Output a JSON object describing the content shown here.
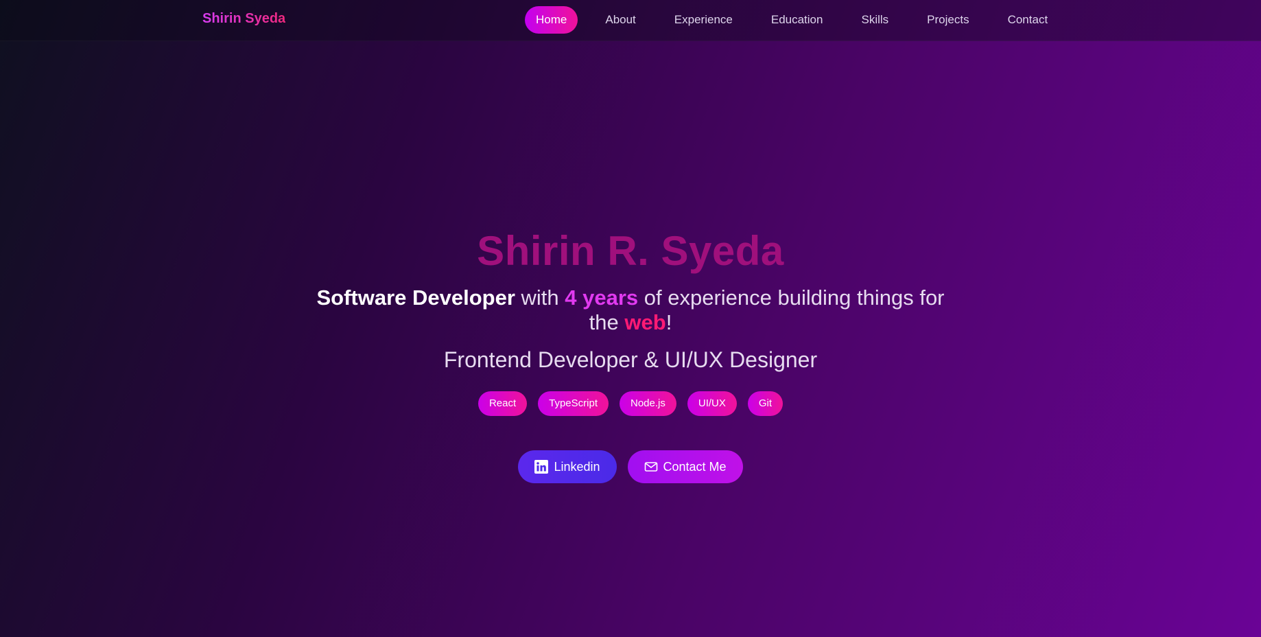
{
  "nav": {
    "brand": "Shirin Syeda",
    "links": [
      {
        "label": "Home",
        "active": true
      },
      {
        "label": "About",
        "active": false
      },
      {
        "label": "Experience",
        "active": false
      },
      {
        "label": "Education",
        "active": false
      },
      {
        "label": "Skills",
        "active": false
      },
      {
        "label": "Projects",
        "active": false
      },
      {
        "label": "Contact",
        "active": false
      }
    ]
  },
  "hero": {
    "name": "Shirin R. Syeda",
    "tagline": {
      "title": "Software Developer",
      "with": " with ",
      "years": "4 years",
      "mid": " of experience building things for the ",
      "web": "web",
      "end": "!"
    },
    "role": "Frontend Developer & UI/UX Designer",
    "skills": [
      "React",
      "TypeScript",
      "Node.js",
      "UI/UX",
      "Git"
    ],
    "buttons": {
      "linkedin": "Linkedin",
      "contact": "Contact Me"
    }
  },
  "colors": {
    "accent_pink": "#f0129a",
    "accent_purple": "#c300f0",
    "name_color": "#a0107c",
    "linkedin_blue": "#4b2ae8"
  },
  "icons": {
    "linkedin": "linkedin-icon",
    "contact": "mail-icon"
  }
}
